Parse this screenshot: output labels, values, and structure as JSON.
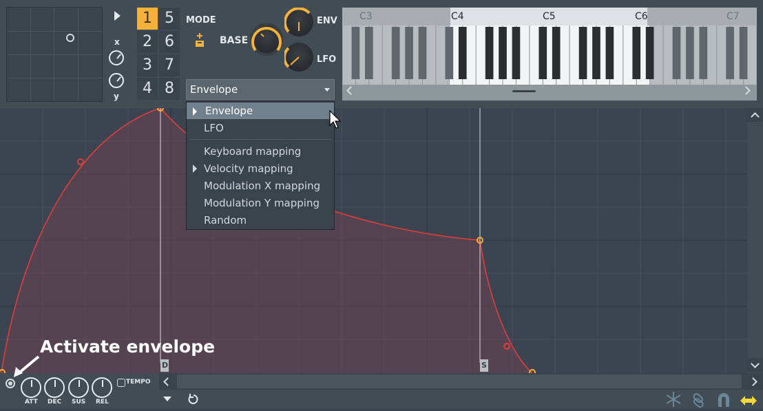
{
  "xy_pad": {
    "x_label": "x",
    "y_label": "y"
  },
  "number_buttons": [
    {
      "label": "1",
      "active": true
    },
    {
      "label": "5",
      "active": false
    },
    {
      "label": "2",
      "active": false
    },
    {
      "label": "6",
      "active": false
    },
    {
      "label": "3",
      "active": false
    },
    {
      "label": "7",
      "active": false
    },
    {
      "label": "4",
      "active": false
    },
    {
      "label": "8",
      "active": false
    }
  ],
  "mode_label": "MODE",
  "base_label": "BASE",
  "env_label": "ENV",
  "lfo_label": "LFO",
  "target_dropdown": {
    "value": "Envelope"
  },
  "keyboard": {
    "octave_labels": [
      "C3",
      "C4",
      "C5",
      "C6",
      "C7"
    ]
  },
  "dropdown_menu": [
    {
      "label": "Envelope",
      "selected": true,
      "submenu": false
    },
    {
      "label": "LFO",
      "selected": false,
      "submenu": false
    },
    {
      "label": "Keyboard mapping",
      "selected": false,
      "submenu": false
    },
    {
      "label": "Velocity mapping",
      "selected": false,
      "submenu": true
    },
    {
      "label": "Modulation X mapping",
      "selected": false,
      "submenu": false
    },
    {
      "label": "Modulation Y mapping",
      "selected": false,
      "submenu": false
    },
    {
      "label": "Random",
      "selected": false,
      "submenu": false
    }
  ],
  "envelope_markers": {
    "decay": "D",
    "sustain": "S"
  },
  "adsr_knobs": [
    "ATT",
    "DEC",
    "SUS",
    "REL"
  ],
  "tempo_label": "TEMPO",
  "callout_text": "Activate envelope",
  "colors": {
    "accent": "#f6b13a",
    "curve": "#e03e3a",
    "selection": "#70808c"
  }
}
